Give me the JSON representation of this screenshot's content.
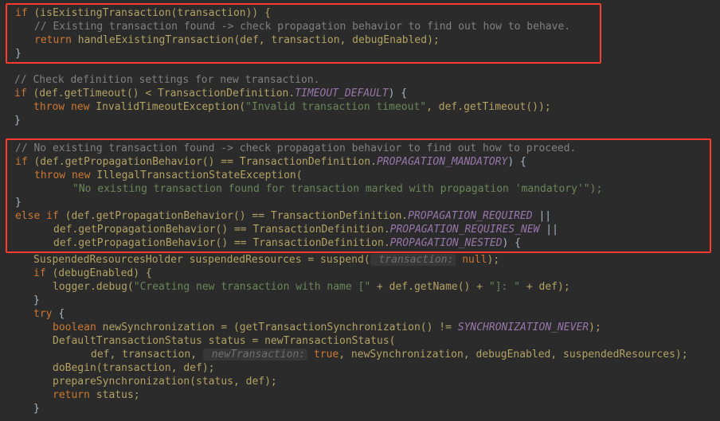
{
  "code": {
    "block1": {
      "l1": {
        "a": "if ",
        "b": "(isExistingTransaction(transaction)) {"
      },
      "l2": "// Existing transaction found -> check propagation behavior to find out how to behave.",
      "l3": {
        "a": "return ",
        "b": "handleExistingTransaction(def, transaction, debugEnabled);"
      },
      "l4": "}"
    },
    "block2": {
      "l1": "// Check definition settings for new transaction.",
      "l2": {
        "a": "if ",
        "b": "(def.getTimeout() < TransactionDefinition.",
        "c": "TIMEOUT_DEFAULT",
        "d": ") {"
      },
      "l3": {
        "a": "throw new ",
        "b": "InvalidTimeoutException(",
        "c": "\"Invalid transaction timeout\"",
        "d": ", def.getTimeout());"
      },
      "l4": "}"
    },
    "block3": {
      "l1": "// No existing transaction found -> check propagation behavior to find out how to proceed.",
      "l2": {
        "a": "if ",
        "b": "(def.getPropagationBehavior() == TransactionDefinition.",
        "c": "PROPAGATION_MANDATORY",
        "d": ") {"
      },
      "l3": {
        "a": "throw new ",
        "b": "IllegalTransactionStateException("
      },
      "l4": "\"No existing transaction found for transaction marked with propagation 'mandatory'\");",
      "l5": "}",
      "l6": {
        "a": "else if ",
        "b": "(def.getPropagationBehavior() == TransactionDefinition.",
        "c": "PROPAGATION_REQUIRED",
        "d": " ||"
      },
      "l7": {
        "b": "def.getPropagationBehavior() == TransactionDefinition.",
        "c": "PROPAGATION_REQUIRES_NEW",
        "d": " ||"
      },
      "l8": {
        "b": "def.getPropagationBehavior() == TransactionDefinition.",
        "c": "PROPAGATION_NESTED",
        "d": ") {"
      }
    },
    "block4": {
      "l1": {
        "a": "SuspendedResourcesHolder suspendedResources = suspend(",
        "h": " transaction:",
        "b": " ",
        "c": "null",
        "d": ");"
      },
      "l2": {
        "a": "if ",
        "b": "(debugEnabled) {"
      },
      "l3": {
        "a": "logger.debug(",
        "b": "\"Creating new transaction with name [\"",
        "c": " + def.getName() + ",
        "d": "\"]: \"",
        "e": " + def);"
      },
      "l4": "}",
      "l5": {
        "a": "try ",
        "b": "{"
      },
      "l6": {
        "a": "boolean ",
        "b": "newSynchronization = (getTransactionSynchronization() != ",
        "c": "SYNCHRONIZATION_NEVER",
        "d": ");"
      },
      "l7": "DefaultTransactionStatus status = newTransactionStatus(",
      "l8": {
        "a": "def, transaction, ",
        "h": " newTransaction:",
        "b": " ",
        "c": "true",
        "d": ", newSynchronization, debugEnabled, suspendedResources);"
      },
      "l9": "doBegin(transaction, def);",
      "l10": "prepareSynchronization(status, def);",
      "l11": {
        "a": "return ",
        "b": "status;"
      },
      "l12": "}"
    }
  }
}
